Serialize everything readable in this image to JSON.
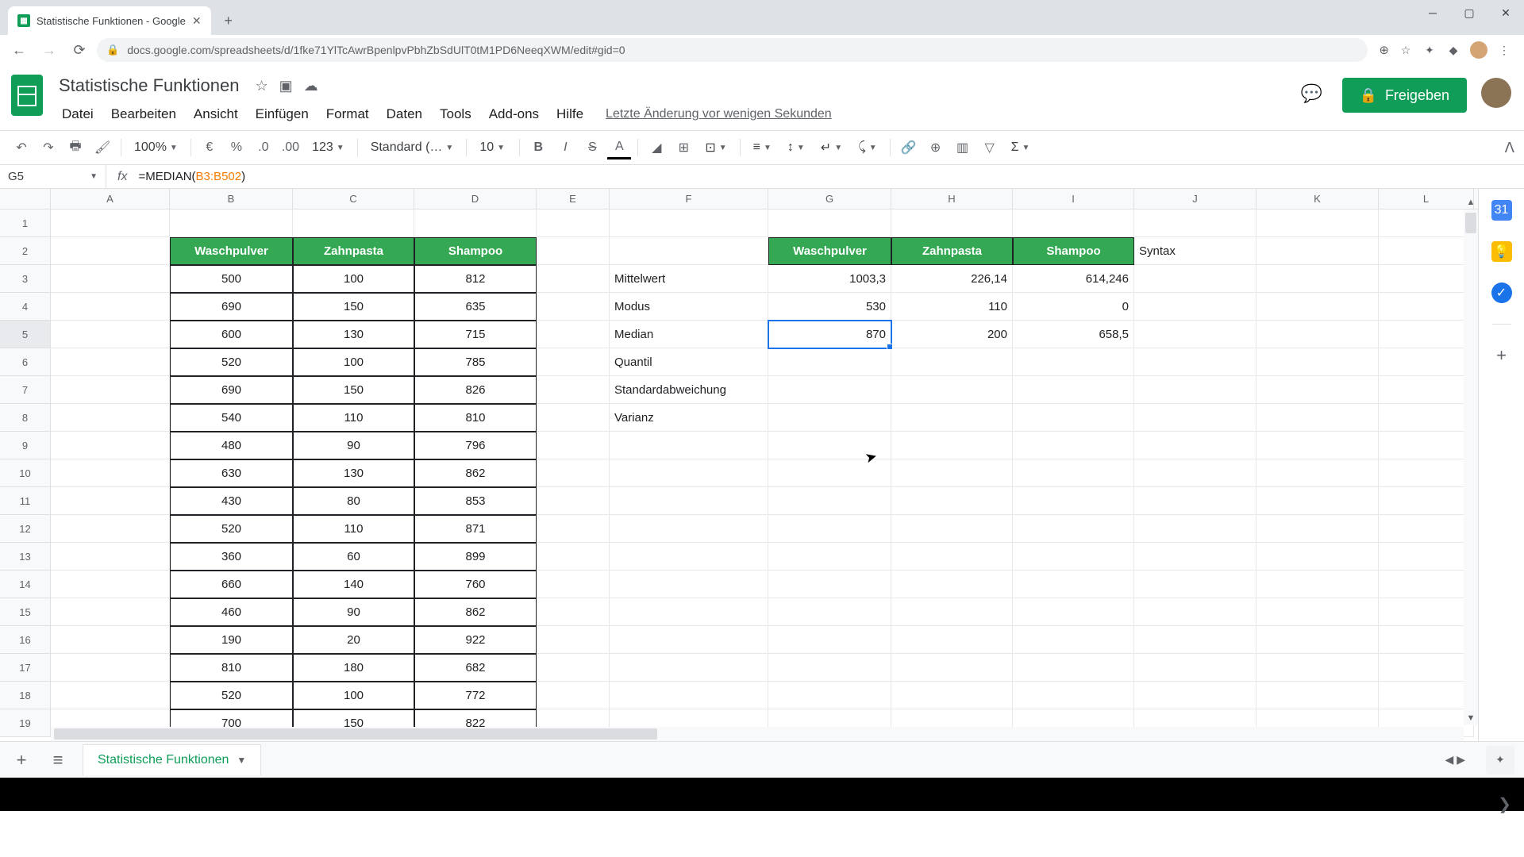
{
  "browser": {
    "tab_title": "Statistische Funktionen - Google",
    "url": "docs.google.com/spreadsheets/d/1fke71YlTcAwrBpenlpvPbhZbSdUlT0tM1PD6NeeqXWM/edit#gid=0"
  },
  "doc": {
    "title": "Statistische Funktionen",
    "last_edit": "Letzte Änderung vor wenigen Sekunden"
  },
  "menu": {
    "datei": "Datei",
    "bearbeiten": "Bearbeiten",
    "ansicht": "Ansicht",
    "einfuegen": "Einfügen",
    "format": "Format",
    "daten": "Daten",
    "tools": "Tools",
    "addons": "Add-ons",
    "hilfe": "Hilfe"
  },
  "share_label": "Freigeben",
  "toolbar": {
    "zoom": "100%",
    "euro": "€",
    "percent": "%",
    "dec_minus": ".0̲",
    "dec_plus": ".00̲",
    "format_123": "123",
    "font": "Standard (…",
    "size": "10"
  },
  "name_box": "G5",
  "formula": {
    "head": "=MEDIAN(",
    "ref": "B3:B502",
    "tail": ")"
  },
  "cols": [
    "A",
    "B",
    "C",
    "D",
    "E",
    "F",
    "G",
    "H",
    "I",
    "J",
    "K",
    "L"
  ],
  "rows": [
    "1",
    "2",
    "3",
    "4",
    "5",
    "6",
    "7",
    "8",
    "9",
    "10",
    "11",
    "12",
    "13",
    "14",
    "15",
    "16",
    "17",
    "18",
    "19"
  ],
  "headers_left": {
    "B": "Waschpulver",
    "C": "Zahnpasta",
    "D": "Shampoo"
  },
  "headers_right": {
    "G": "Waschpulver",
    "H": "Zahnpasta",
    "I": "Shampoo",
    "J": "Syntax"
  },
  "stats_labels": {
    "r3": "Mittelwert",
    "r4": "Modus",
    "r5": "Median",
    "r6": "Quantil",
    "r7": "Standardabweichung",
    "r8": "Varianz"
  },
  "stats_values": {
    "r3": {
      "G": "1003,3",
      "H": "226,14",
      "I": "614,246"
    },
    "r4": {
      "G": "530",
      "H": "110",
      "I": "0"
    },
    "r5": {
      "G": "870",
      "H": "200",
      "I": "658,5"
    }
  },
  "chart_data": {
    "type": "table",
    "columns": [
      "Waschpulver",
      "Zahnpasta",
      "Shampoo"
    ],
    "rows": [
      [
        500,
        100,
        812
      ],
      [
        690,
        150,
        635
      ],
      [
        600,
        130,
        715
      ],
      [
        520,
        100,
        785
      ],
      [
        690,
        150,
        826
      ],
      [
        540,
        110,
        810
      ],
      [
        480,
        90,
        796
      ],
      [
        630,
        130,
        862
      ],
      [
        430,
        80,
        853
      ],
      [
        520,
        110,
        871
      ],
      [
        360,
        60,
        899
      ],
      [
        660,
        140,
        760
      ],
      [
        460,
        90,
        862
      ],
      [
        190,
        20,
        922
      ],
      [
        810,
        180,
        682
      ],
      [
        520,
        100,
        772
      ],
      [
        700,
        150,
        822
      ]
    ]
  },
  "sheet_tab": "Statistische Funktionen"
}
